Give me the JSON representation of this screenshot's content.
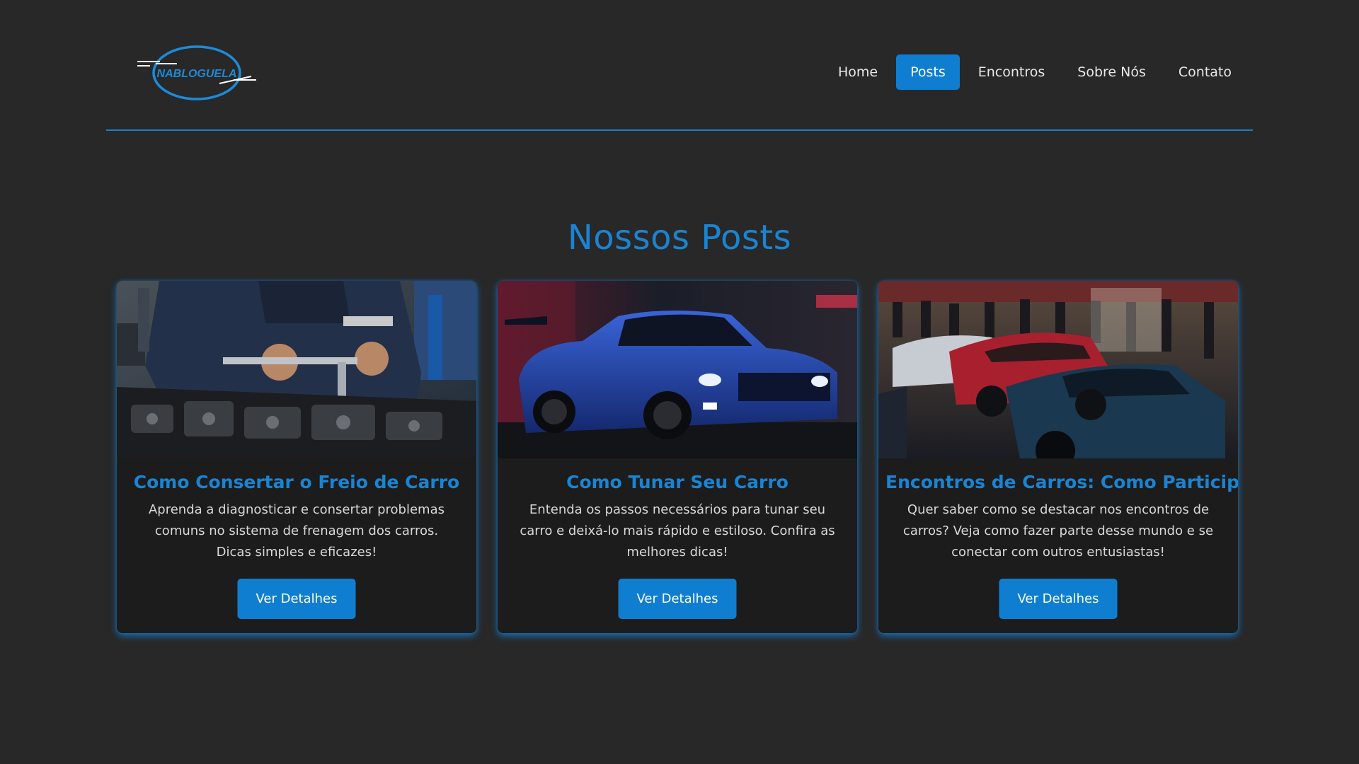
{
  "header": {
    "logo_text": "NABLOGUELA",
    "nav": [
      {
        "label": "Home",
        "active": false
      },
      {
        "label": "Posts",
        "active": true
      },
      {
        "label": "Encontros",
        "active": false
      },
      {
        "label": "Sobre Nós",
        "active": false
      },
      {
        "label": "Contato",
        "active": false
      }
    ]
  },
  "main": {
    "title": "Nossos Posts",
    "posts": [
      {
        "image": "mechanic-repairing-engine",
        "title": "Como Consertar o Freio de Carro",
        "description": "Aprenda a diagnosticar e consertar problemas comuns no sistema de frenagem dos carros. Dicas simples e eficazes!",
        "button": "Ver Detalhes"
      },
      {
        "image": "blue-sports-car-night",
        "title": "Como Tunar Seu Carro",
        "description": "Entenda os passos necessários para tunar seu carro e deixá-lo mais rápido e estiloso. Confira as melhores dicas!",
        "button": "Ver Detalhes"
      },
      {
        "image": "car-meet-crowd",
        "title": "Encontros de Carros: Como Participar",
        "description": "Quer saber como se destacar nos encontros de carros? Veja como fazer parte desse mundo e se conectar com outros entusiastas!",
        "button": "Ver Detalhes"
      }
    ]
  },
  "colors": {
    "background": "#282828",
    "accent": "#0f7ed0",
    "title": "#1a84d2",
    "card": "#1c1c1c"
  }
}
